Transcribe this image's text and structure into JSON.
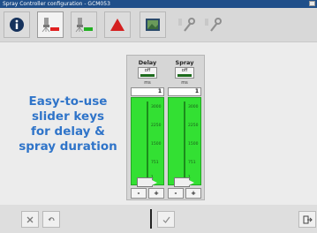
{
  "window": {
    "title": "Spray Controller configuration - GCM053"
  },
  "tabs": [
    {
      "name": "info",
      "icon": "info-icon",
      "state": "normal"
    },
    {
      "name": "delay-spray",
      "icon": "nozzle-green-icon",
      "state": "active"
    },
    {
      "name": "spray-green",
      "icon": "nozzle-green-icon",
      "state": "normal"
    },
    {
      "name": "warning",
      "icon": "warning-triangle-icon",
      "state": "normal"
    },
    {
      "name": "image-tab",
      "icon": "photo-icon",
      "state": "normal"
    },
    {
      "name": "tool-1",
      "icon": "wrench-icon",
      "state": "disabled"
    },
    {
      "name": "tool-2",
      "icon": "wrench-icon",
      "state": "disabled"
    }
  ],
  "promo": {
    "line1": "Easy-to-use",
    "line2": "slider keys",
    "line3": "for delay &",
    "line4": "spray duration"
  },
  "delay": {
    "title": "Delay",
    "off_label": "off",
    "unit": "ms",
    "value": "1",
    "ticks": [
      "3000",
      "2250",
      "1500",
      "751",
      "1"
    ],
    "level": 0.0,
    "minus": "-",
    "plus": "+"
  },
  "spray": {
    "title": "Spray",
    "off_label": "off",
    "unit": "ms",
    "value": "1",
    "ticks": [
      "3000",
      "2250",
      "1500",
      "751",
      "1"
    ],
    "level": 0.0,
    "minus": "-",
    "plus": "+"
  },
  "colors": {
    "accent": "#2f74c9",
    "slider_green": "#33e033",
    "titlebar": "#1f4f8a"
  },
  "bottom": {
    "cancel_icon": "close-x-icon",
    "undo_icon": "undo-icon",
    "confirm_icon": "checkmark-icon",
    "exit_icon": "exit-icon"
  }
}
